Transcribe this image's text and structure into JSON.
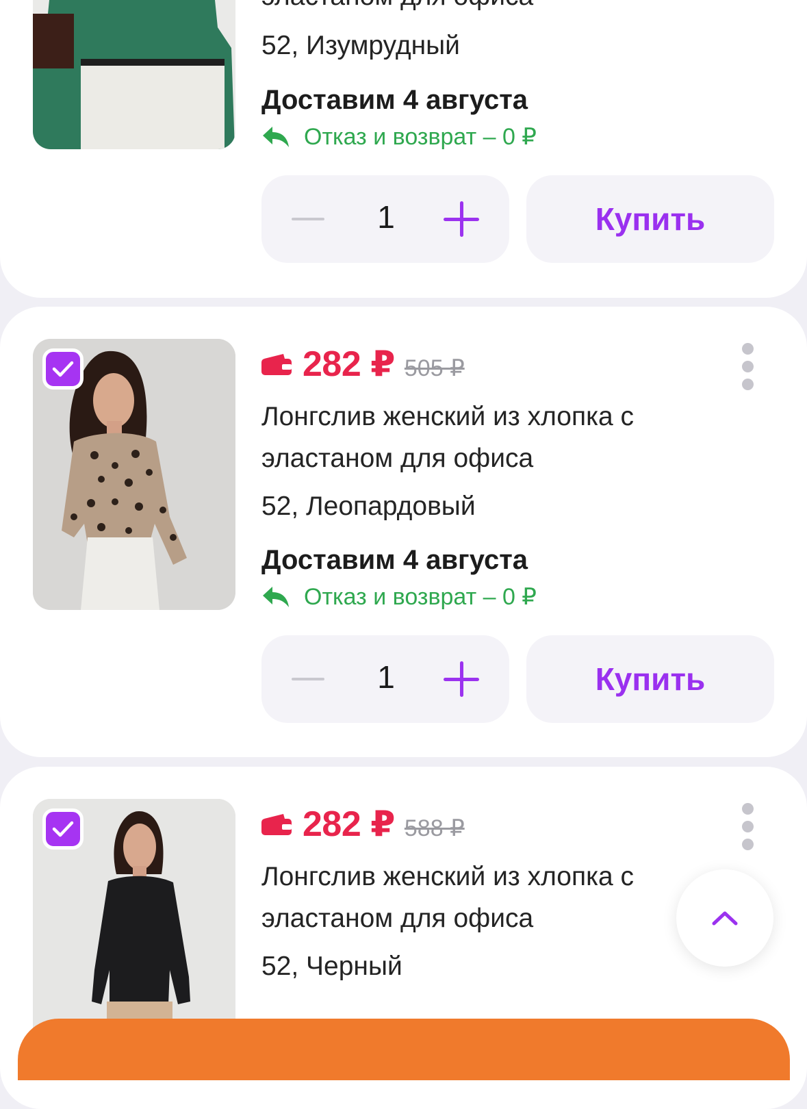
{
  "colors": {
    "accent": "#9b32ef",
    "price": "#e8244c",
    "refund": "#2fa84f",
    "order_bar": "#f07a2c"
  },
  "items": [
    {
      "title_fragment": "эластаном для офиса",
      "variant": "52, Изумрудный",
      "delivery": "Доставим 4 августа",
      "refund": "Отказ и возврат – 0 ₽",
      "quantity": "1",
      "buy_label": "Купить"
    },
    {
      "selected": true,
      "price": "282 ₽",
      "old_price": "505 ₽",
      "title": "Лонгслив женский из хлопка с эластаном для офиса",
      "variant": "52, Леопардовый",
      "delivery": "Доставим 4 августа",
      "refund": "Отказ и возврат – 0 ₽",
      "quantity": "1",
      "buy_label": "Купить"
    },
    {
      "selected": true,
      "price": "282 ₽",
      "old_price": "588 ₽",
      "title": "Лонгслив женский из хлопка с эластаном для офиса",
      "variant": "52, Черный"
    }
  ],
  "icons": [
    "wallet-icon",
    "reply-arrow-icon",
    "checkmark-icon",
    "more-vertical-icon",
    "chevron-up-icon"
  ]
}
